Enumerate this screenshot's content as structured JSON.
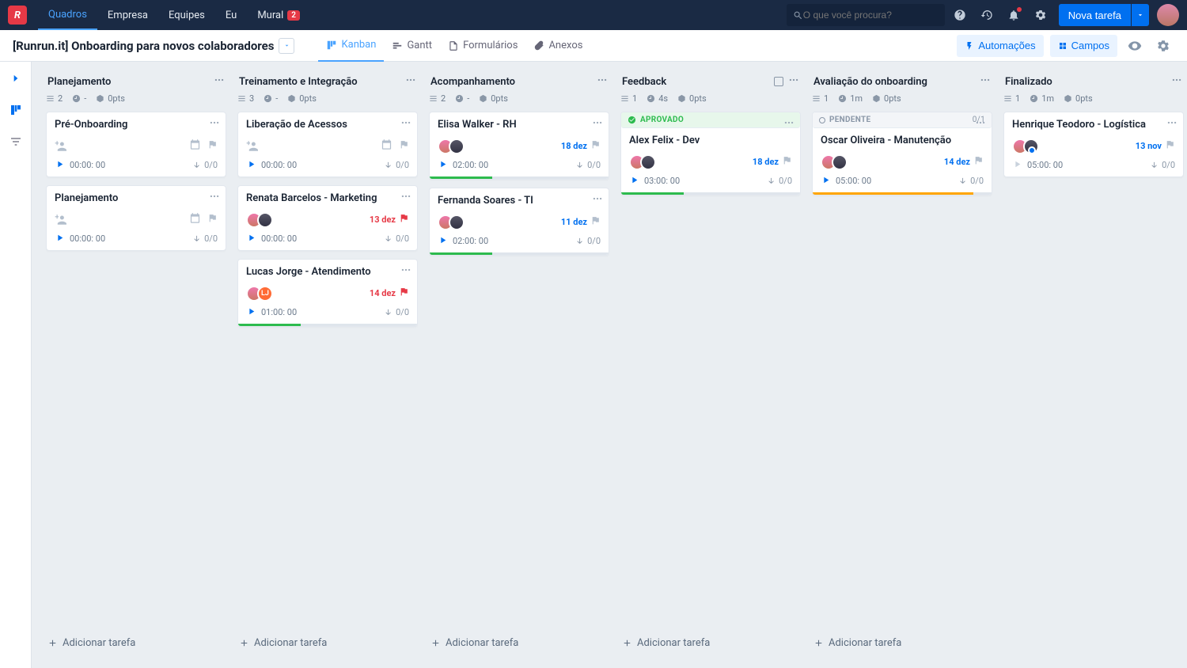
{
  "nav": {
    "items": [
      "Quadros",
      "Empresa",
      "Equipes",
      "Eu",
      "Mural"
    ],
    "mural_badge": "2",
    "search_placeholder": "O que você procura?",
    "new_task": "Nova tarefa"
  },
  "subheader": {
    "board_title": "[Runrun.it] Onboarding para novos colaboradores",
    "views": [
      "Kanban",
      "Gantt",
      "Formulários",
      "Anexos"
    ],
    "automations": "Automações",
    "fields": "Campos"
  },
  "columns": [
    {
      "title": "Planejamento",
      "count": "2",
      "time": "-",
      "pts": "0pts",
      "cards": [
        {
          "title": "Pré-Onboarding",
          "ghost": true,
          "timer": "00:00: 00",
          "subtasks": "0/0"
        },
        {
          "title": "Planejamento",
          "ghost": true,
          "timer": "00:00: 00",
          "subtasks": "0/0"
        }
      ],
      "add": true
    },
    {
      "title": "Treinamento e Integração",
      "count": "3",
      "time": "-",
      "pts": "0pts",
      "cards": [
        {
          "title": "Liberação de Acessos",
          "ghost": true,
          "timer": "00:00: 00",
          "subtasks": "0/0"
        },
        {
          "title": "Renata Barcelos - Marketing",
          "avatars": 2,
          "due": "13 dez",
          "flag": "red",
          "timer": "00:00: 00",
          "subtasks": "0/0"
        },
        {
          "title": "Lucas Jorge - Atendimento",
          "avatars": 2,
          "avatar_text": "LJ",
          "due": "14 dez",
          "flag": "red",
          "timer": "01:00: 00",
          "subtasks": "0/0",
          "progress": "green"
        }
      ],
      "add": true
    },
    {
      "title": "Acompanhamento",
      "count": "2",
      "time": "-",
      "pts": "0pts",
      "cards": [
        {
          "title": "Elisa Walker - RH",
          "avatars": 2,
          "due": "18 dez",
          "flag": "gray",
          "timer": "02:00: 00",
          "subtasks": "0/0",
          "progress": "green"
        },
        {
          "title": "Fernanda Soares - TI",
          "avatars": 2,
          "due": "11 dez",
          "flag": "gray",
          "timer": "02:00: 00",
          "subtasks": "0/0",
          "progress": "green"
        }
      ],
      "add": true
    },
    {
      "title": "Feedback",
      "count": "1",
      "time": "4s",
      "pts": "0pts",
      "checkbox": true,
      "cards": [
        {
          "status": "APROVADO",
          "status_type": "approved",
          "title": "Alex Felix - Dev",
          "avatars": 2,
          "due": "18 dez",
          "flag": "gray",
          "timer": "03:00: 00",
          "subtasks": "0/0",
          "progress": "green"
        }
      ],
      "add": true
    },
    {
      "title": "Avaliação do onboarding",
      "count": "1",
      "time": "1m",
      "pts": "0pts",
      "cards": [
        {
          "status": "PENDENTE",
          "status_type": "pending",
          "status_right": "0/1",
          "title": "Oscar Oliveira - Manutenção",
          "avatars": 2,
          "due": "14 dez",
          "flag": "gray",
          "timer": "05:00: 00",
          "subtasks": "0/0",
          "progress": "orange"
        }
      ],
      "add": true
    },
    {
      "title": "Finalizado",
      "count": "1",
      "time": "1m",
      "pts": "0pts",
      "cards": [
        {
          "title": "Henrique Teodoro - Logística",
          "avatars": 2,
          "checked": true,
          "due": "13 nov",
          "flag": "gray",
          "timer": "05:00: 00",
          "subtasks": "0/0",
          "play_disabled": true
        }
      ],
      "add": false
    }
  ],
  "add_task_label": "Adicionar tarefa"
}
